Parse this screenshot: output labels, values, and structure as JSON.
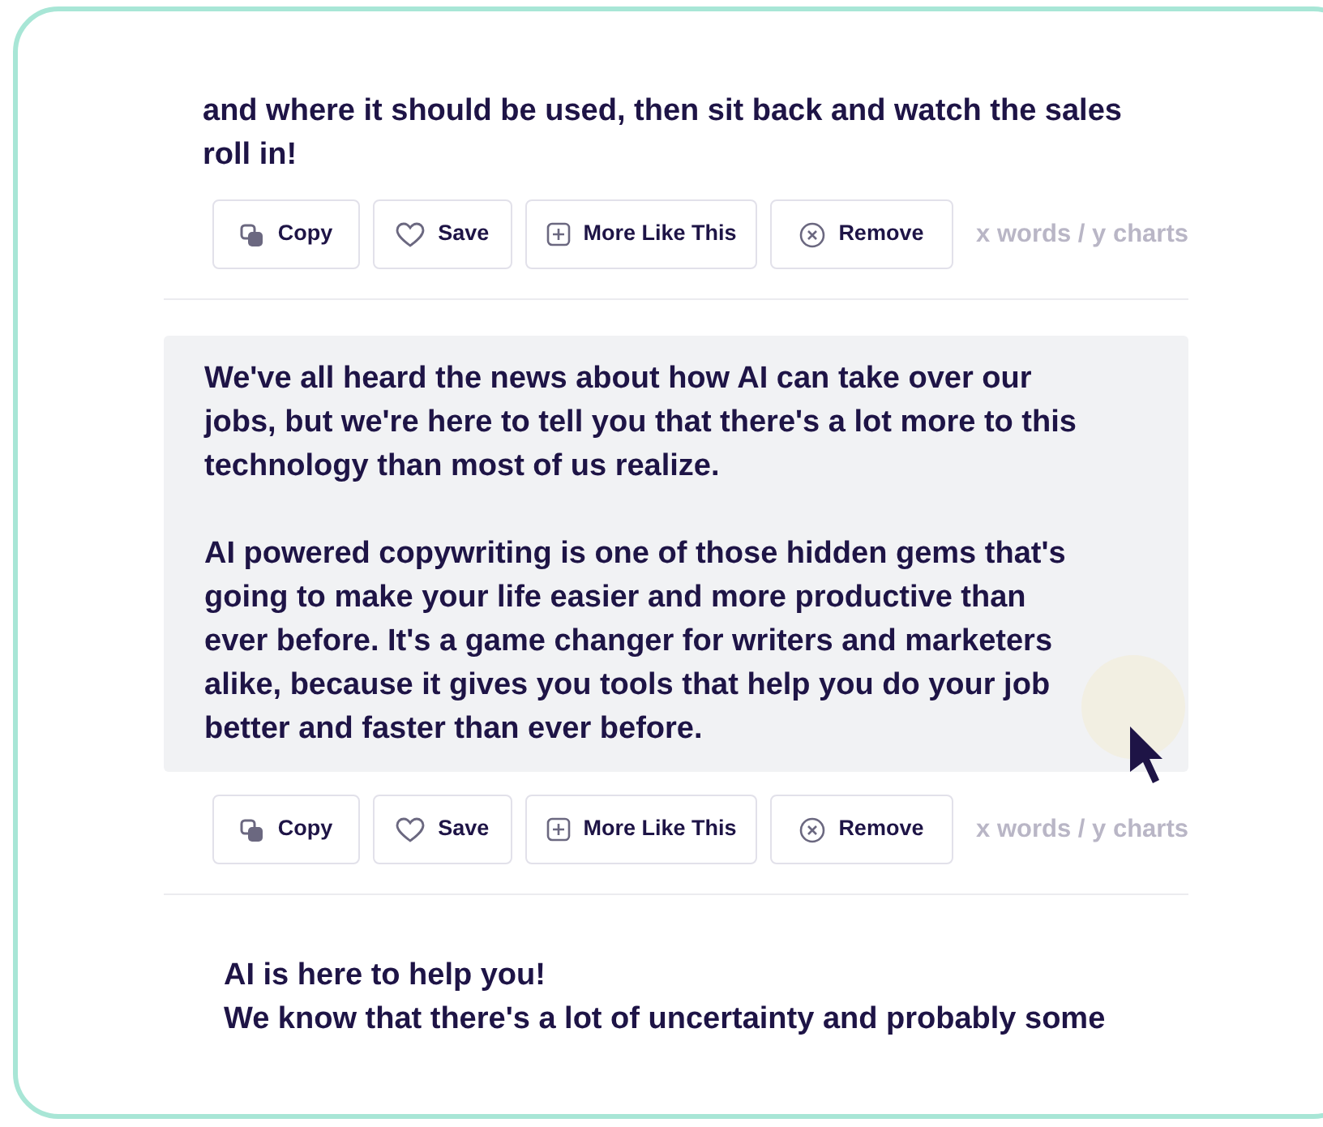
{
  "results": [
    {
      "paragraphs": [
        "and where it should be used, then sit back and watch the sales roll in!"
      ],
      "selected": false,
      "actions": [
        {
          "kind": "copy",
          "label": "Copy"
        },
        {
          "kind": "save",
          "label": "Save"
        },
        {
          "kind": "more",
          "label": "More Like This"
        },
        {
          "kind": "remove",
          "label": "Remove"
        }
      ],
      "count": "x words / y charts"
    },
    {
      "paragraphs": [
        "We've all heard the news about how AI can take over our jobs, but we're here to tell you that there's a lot more to this technology than most of us realize.",
        "AI powered copywriting is one of those hidden gems that's going to make your life easier and more productive than ever before. It's a game changer for writers and marketers alike, because it gives you tools that help you do your job better and faster than ever before."
      ],
      "selected": true,
      "actions": [
        {
          "kind": "copy",
          "label": "Copy"
        },
        {
          "kind": "save",
          "label": "Save"
        },
        {
          "kind": "more",
          "label": "More Like This"
        },
        {
          "kind": "remove",
          "label": "Remove"
        }
      ],
      "count": "x words / y charts"
    },
    {
      "paragraphs": [
        "AI is here to help you!",
        "We know that there's a lot of uncertainty and probably some"
      ],
      "selected": false
    }
  ]
}
